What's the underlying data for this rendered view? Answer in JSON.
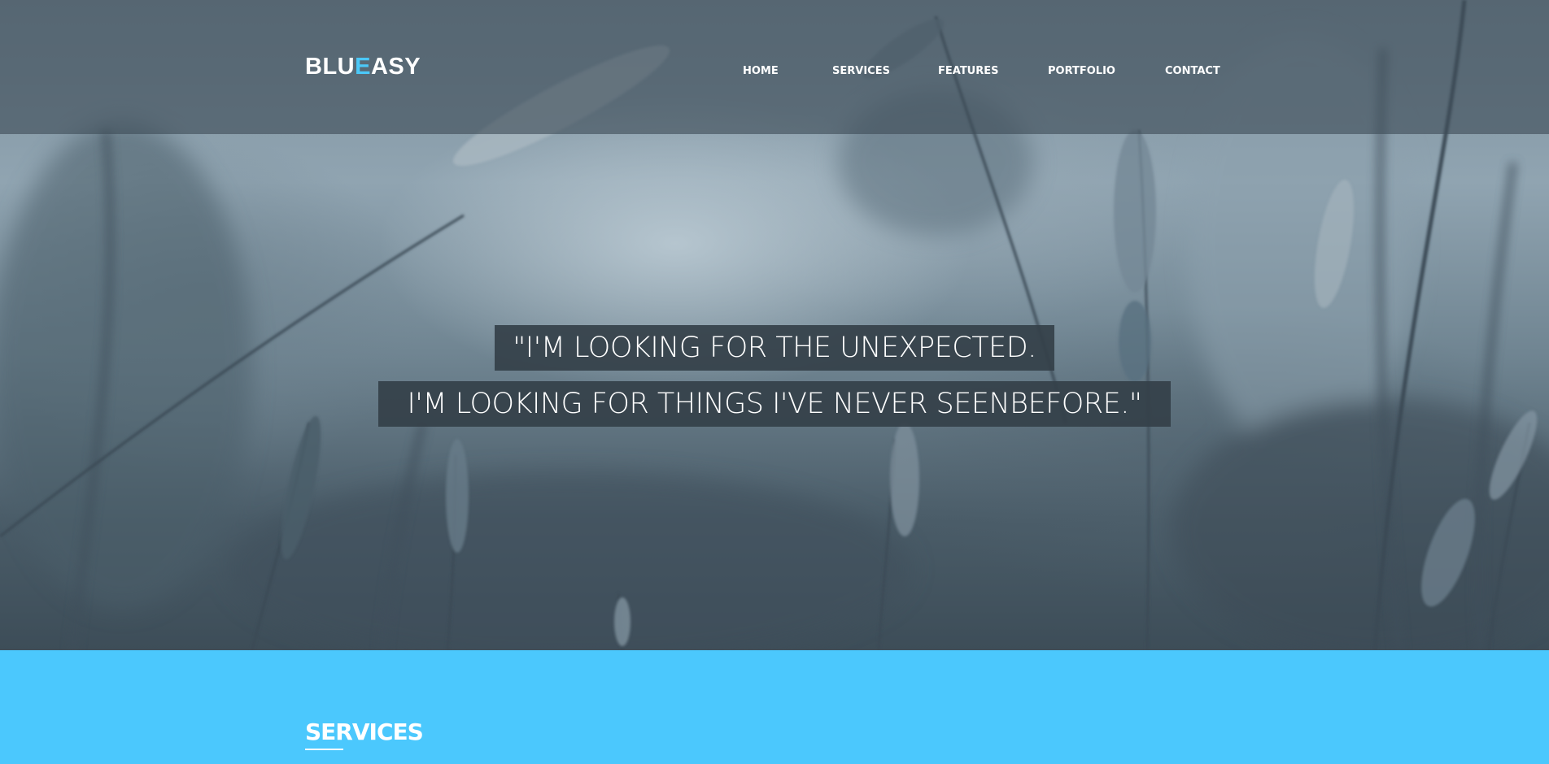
{
  "brand": {
    "logo_part1": "BLU",
    "logo_accent": "E",
    "logo_part2": "ASY",
    "accent_color": "#4bc8f8"
  },
  "nav": {
    "items": [
      "HOME",
      "SERVICES",
      "FEATURES",
      "PORTFOLIO",
      "CONTACT"
    ]
  },
  "hero": {
    "quote_line1": "\"I'M LOOKING FOR THE UNEXPECTED.",
    "quote_line2": "I'M LOOKING FOR THINGS I'VE NEVER SEENBEFORE.\""
  },
  "services": {
    "title": "SERVICES",
    "background_color": "#4bc8fd"
  }
}
